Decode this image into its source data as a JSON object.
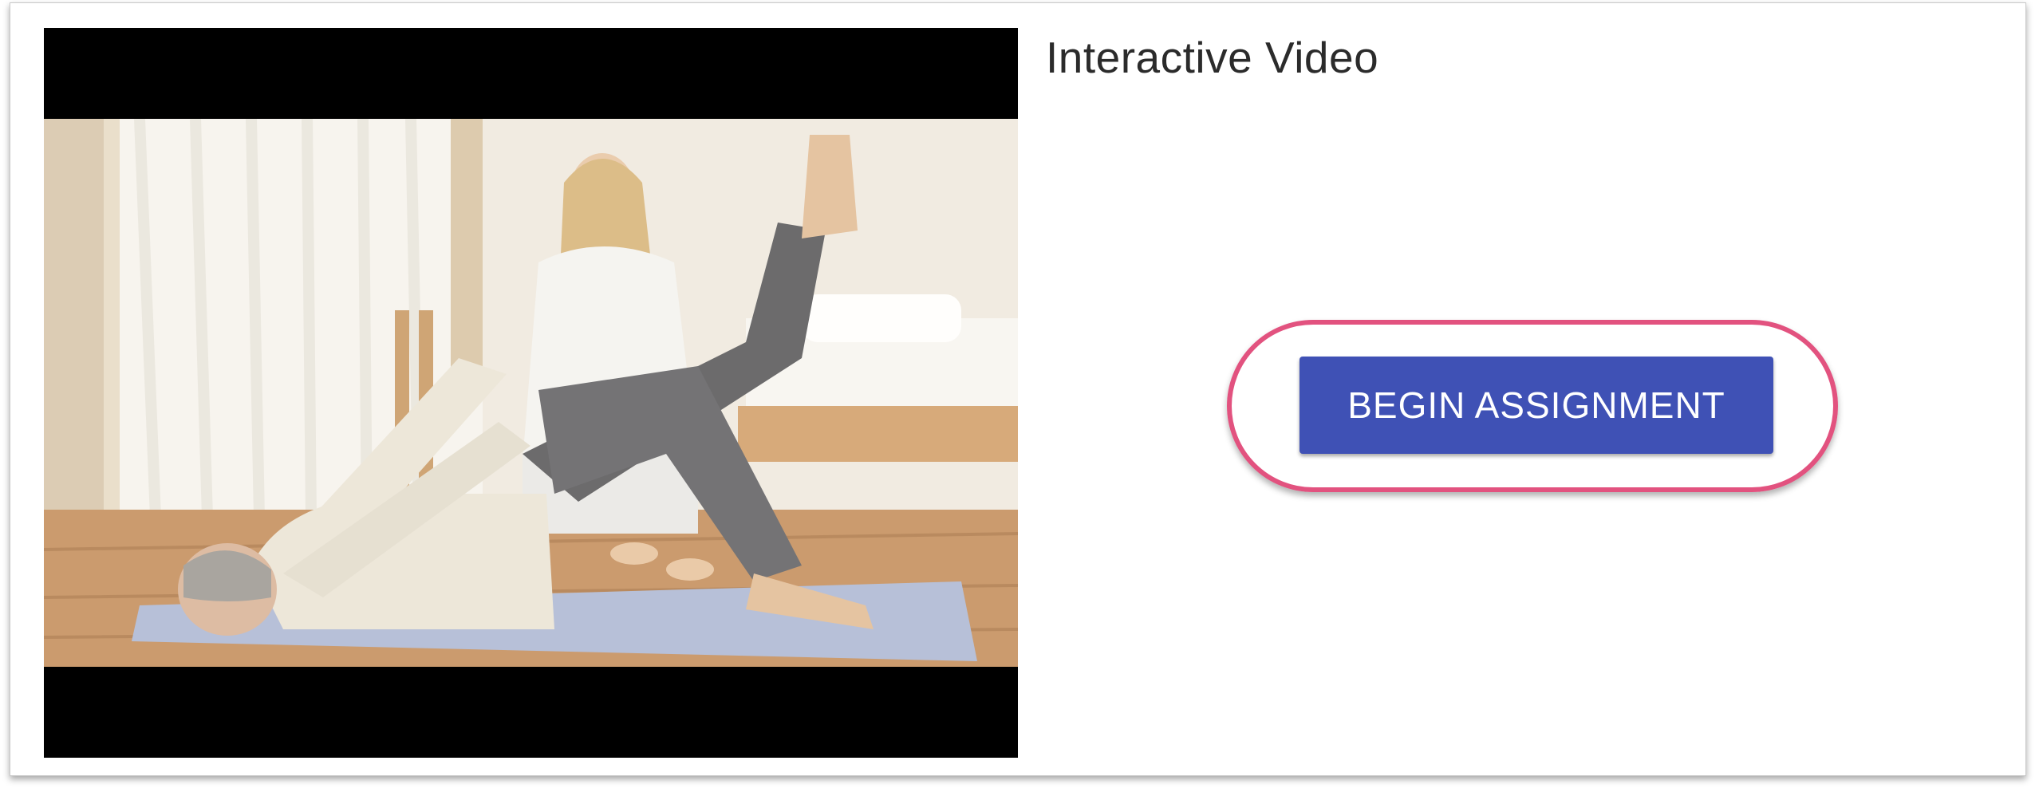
{
  "main": {
    "title": "Interactive Video",
    "begin_button_label": "BEGIN ASSIGNMENT"
  },
  "video": {
    "scene": "physiotherapist assisting a man doing a leg raise exercise on a yoga mat"
  },
  "colors": {
    "button": "#3f51b5",
    "highlight_ring": "#e2527f",
    "letterbox": "#000000"
  }
}
